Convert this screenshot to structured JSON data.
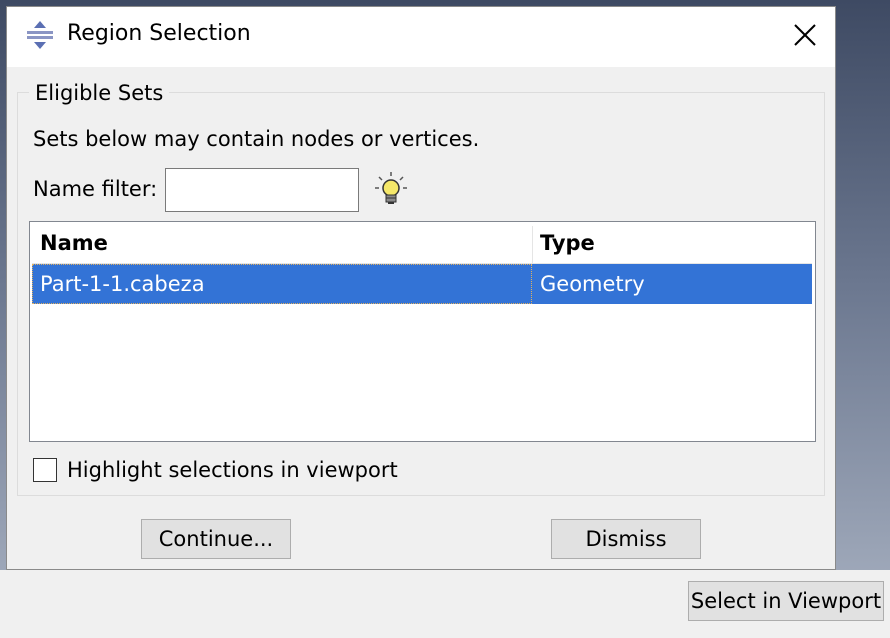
{
  "dialog": {
    "title": "Region Selection",
    "icons": {
      "app": "region-selection-icon",
      "close": "close-icon"
    }
  },
  "eligible_sets": {
    "legend": "Eligible Sets",
    "description": "Sets below may contain nodes or vertices.",
    "filter": {
      "label": "Name filter:",
      "value": "",
      "placeholder": ""
    },
    "hint_icon": "lightbulb-icon",
    "table": {
      "columns": [
        "Name",
        "Type"
      ],
      "rows": [
        {
          "name": "Part-1-1.cabeza",
          "type": "Geometry",
          "selected": true
        }
      ]
    },
    "highlight": {
      "label": "Highlight selections in viewport",
      "checked": false
    }
  },
  "buttons": {
    "continue": "Continue...",
    "dismiss": "Dismiss"
  },
  "background": {
    "select_in_viewport": "Select in Viewport"
  },
  "colors": {
    "selection": "#3373d6",
    "dialog_bg": "#f0f0f0"
  }
}
